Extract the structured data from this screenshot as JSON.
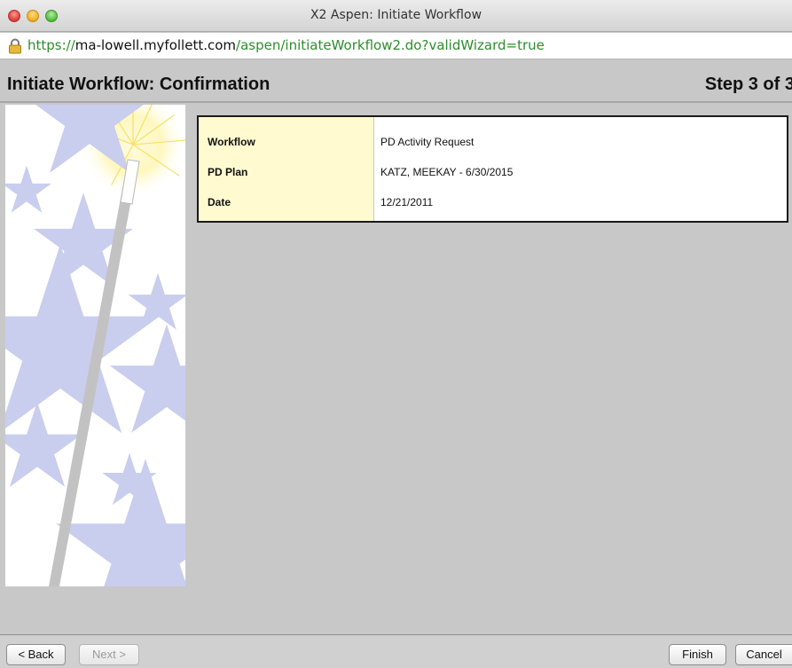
{
  "window": {
    "title": "X2 Aspen: Initiate Workflow"
  },
  "url": {
    "protocol": "https://",
    "host": "ma-lowell.myfollett.com",
    "path": "/aspen/initiateWorkflow2.do?validWizard=true"
  },
  "header": {
    "title": "Initiate Workflow: Confirmation",
    "step": "Step 3 of 3"
  },
  "details": {
    "rows": [
      {
        "label": "Workflow",
        "value": "PD Activity Request"
      },
      {
        "label": "PD Plan",
        "value": "KATZ, MEEKAY - 6/30/2015"
      },
      {
        "label": "Date",
        "value": "12/21/2011"
      }
    ]
  },
  "buttons": {
    "back": "< Back",
    "next": "Next >",
    "finish": "Finish",
    "cancel": "Cancel"
  },
  "colors": {
    "label_bg": "#fffad0",
    "secure_green": "#2c8d2c",
    "star_outline": "#c9cdee",
    "star_glow": "#fbe96a"
  },
  "icons": {
    "lock": "lock-icon",
    "wand": "magic-wand-icon",
    "stars": "star-icon"
  }
}
